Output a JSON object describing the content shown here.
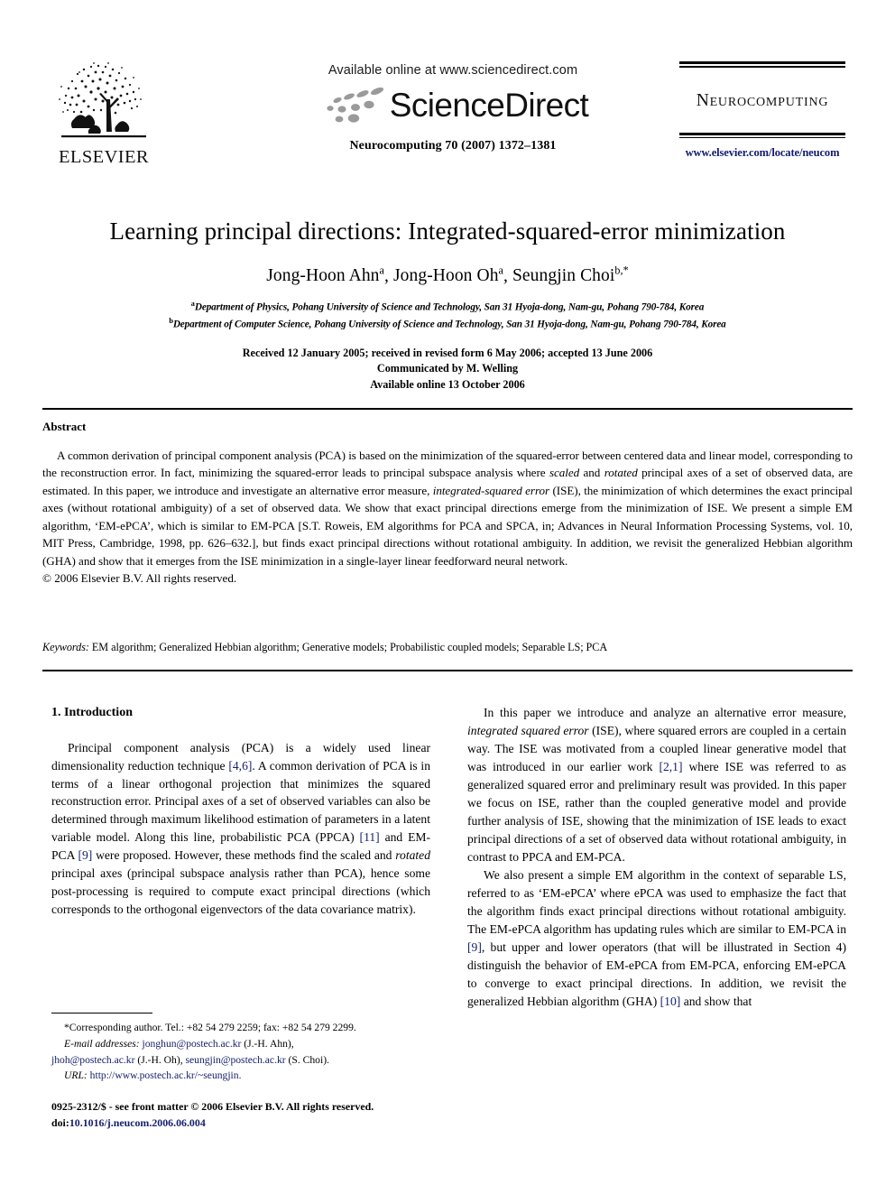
{
  "masthead": {
    "publisher_name": "ELSEVIER",
    "publisher_logo_alt": "elsevier-tree-logo",
    "available_online": "Available online at www.sciencedirect.com",
    "sciencedirect_wordmark": "ScienceDirect",
    "journal_reference": "Neurocomputing 70 (2007) 1372–1381",
    "journal_name": "Neurocomputing",
    "journal_url": "www.elsevier.com/locate/neucom"
  },
  "article": {
    "title": "Learning principal directions: Integrated-squared-error minimization",
    "authors_html": "Jong-Hoon Ahn<sup>a</sup>, Jong-Hoon Oh<sup>a</sup>, Seungjin Choi<sup>b,*</sup>",
    "authors_plain": "Jong-Hoon Ahn a, Jong-Hoon Oh a, Seungjin Choi b,*",
    "affiliations": [
      {
        "marker": "a",
        "text": "Department of Physics, Pohang University of Science and Technology, San 31 Hyoja-dong, Nam-gu, Pohang 790-784, Korea"
      },
      {
        "marker": "b",
        "text": "Department of Computer Science, Pohang University of Science and Technology, San 31 Hyoja-dong, Nam-gu, Pohang 790-784, Korea"
      }
    ],
    "history": [
      "Received 12 January 2005; received in revised form 6 May 2006; accepted 13 June 2006",
      "Communicated by M. Welling",
      "Available online 13 October 2006"
    ]
  },
  "abstract": {
    "heading": "Abstract",
    "text": "A common derivation of principal component analysis (PCA) is based on the minimization of the squared-error between centered data and linear model, corresponding to the reconstruction error. In fact, minimizing the squared-error leads to principal subspace analysis where scaled and rotated principal axes of a set of observed data, are estimated. In this paper, we introduce and investigate an alternative error measure, integrated-squared error (ISE), the minimization of which determines the exact principal axes (without rotational ambiguity) of a set of observed data. We show that exact principal directions emerge from the minimization of ISE. We present a simple EM algorithm, ‘EM-ePCA’, which is similar to EM-PCA [S.T. Roweis, EM algorithms for PCA and SPCA, in; Advances in Neural Information Processing Systems, vol. 10, MIT Press, Cambridge, 1998, pp. 626–632.], but finds exact principal directions without rotational ambiguity. In addition, we revisit the generalized Hebbian algorithm (GHA) and show that it emerges from the ISE minimization in a single-layer linear feedforward neural network.",
    "copyright": "© 2006 Elsevier B.V. All rights reserved."
  },
  "keywords": {
    "label": "Keywords:",
    "text": "EM algorithm; Generalized Hebbian algorithm; Generative models; Probabilistic coupled models; Separable LS; PCA"
  },
  "introduction": {
    "heading": "1.  Introduction",
    "left_paragraph_1_pre": "Principal component analysis (PCA) is a widely used linear dimensionality reduction technique ",
    "left_cite_1": "[4,6]",
    "left_paragraph_1_mid": ". A common derivation of PCA is in terms of a linear orthogonal projection that minimizes the squared reconstruction error. Principal axes of a set of observed variables can also be determined through maximum likelihood estimation of parameters in a latent variable model. Along this line, probabilistic PCA (PPCA) ",
    "left_cite_2": "[11]",
    "left_paragraph_1_mid2": " and EM-PCA ",
    "left_cite_3": "[9]",
    "left_paragraph_1_mid3": " were proposed. However, these methods find the scaled and ",
    "left_italic_1": "rotated",
    "left_paragraph_1_end": " principal axes (principal subspace analysis rather than PCA), hence some post-processing is required to compute exact principal directions (which corresponds to the orthogonal eigenvectors of the data covariance matrix).",
    "right_paragraph_1_pre": "In this paper we introduce and analyze an alternative error measure, ",
    "right_italic_1": "integrated squared error",
    "right_paragraph_1_mid": " (ISE), where squared errors are coupled in a certain way. The ISE was motivated from a coupled linear generative model that was introduced in our earlier work ",
    "right_cite_1": "[2,1]",
    "right_paragraph_1_end": " where ISE was referred to as generalized squared error and preliminary result was provided. In this paper we focus on ISE, rather than the coupled generative model and provide further analysis of ISE, showing that the minimization of ISE leads to exact principal directions of a set of observed data without rotational ambiguity, in contrast to PPCA and EM-PCA.",
    "right_paragraph_2_pre": "We also present a simple EM algorithm in the context of separable LS, referred to as ‘EM-ePCA’ where ePCA was used to emphasize the fact that the algorithm finds exact principal directions without rotational ambiguity. The EM-ePCA algorithm has updating rules which are similar to EM-PCA in ",
    "right_cite_2": "[9]",
    "right_paragraph_2_mid": ", but upper and lower operators (that will be illustrated in Section 4) distinguish the behavior of EM-ePCA from EM-PCA, enforcing EM-ePCA to converge to exact principal directions. In addition, we revisit the generalized Hebbian algorithm (GHA) ",
    "right_cite_3": "[10]",
    "right_paragraph_2_end": " and show that"
  },
  "footnote": {
    "corresponding": "*Corresponding author. Tel.: +82 54 279 2259; fax: +82 54 279 2299.",
    "email_label": "E-mail addresses:",
    "email_1": "jonghun@postech.ac.kr",
    "email_1_name": "(J.-H. Ahn),",
    "email_2": "jhoh@postech.ac.kr",
    "email_2_name": "(J.-H. Oh),",
    "email_3": "seungjin@postech.ac.kr",
    "email_3_name": "(S. Choi).",
    "url_label": "URL:",
    "url_value": "http://www.postech.ac.kr/~seungjin."
  },
  "frontmatter": {
    "issn_line": "0925-2312/$ - see front matter © 2006 Elsevier B.V. All rights reserved.",
    "doi_label": "doi:",
    "doi_value": "10.1016/j.neucom.2006.06.004"
  },
  "colors": {
    "link": "#16206b",
    "text": "#000000",
    "background": "#ffffff"
  }
}
